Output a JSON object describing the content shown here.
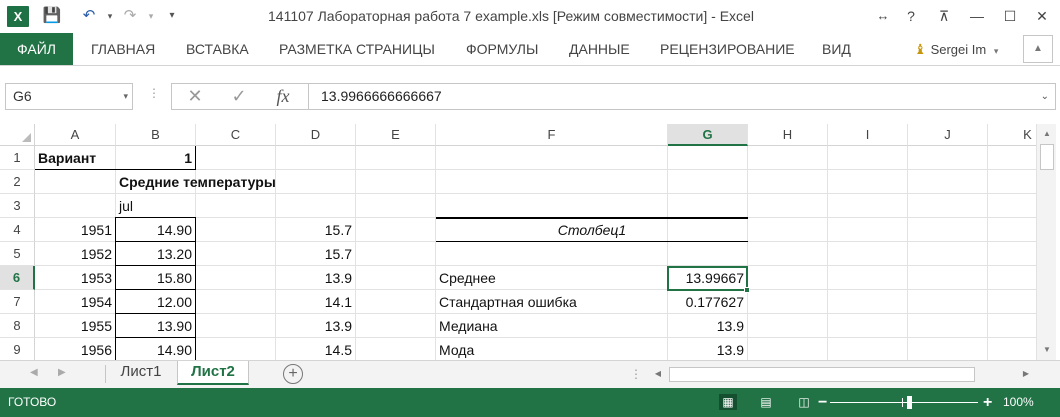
{
  "app": {
    "title": "141107 Лабораторная работа 7 example.xls  [Режим совместимости] - Excel",
    "logo": "X",
    "quick_access": [
      "save-icon",
      "undo-icon",
      "redo-icon",
      "customize-icon"
    ]
  },
  "window_controls": {
    "help": "?",
    "restore_ribbon": "⊼",
    "minimize": "—",
    "maximize": "☐",
    "close": "✕"
  },
  "ribbon": {
    "file_tab": "ФАЙЛ",
    "tabs": [
      "ГЛАВНАЯ",
      "ВСТАВКА",
      "РАЗМЕТКА СТРАНИЦЫ",
      "ФОРМУЛЫ",
      "ДАННЫЕ",
      "РЕЦЕНЗИРОВАНИЕ",
      "ВИД"
    ],
    "user": "Sergei Im"
  },
  "formula_bar": {
    "name_box": "G6",
    "cancel": "✕",
    "enter": "✓",
    "fx": "fx",
    "value": "13.9966666666667"
  },
  "grid": {
    "columns": [
      "A",
      "B",
      "C",
      "D",
      "E",
      "F",
      "G",
      "H",
      "I",
      "J",
      "K"
    ],
    "selected_column": "G",
    "rows": [
      "1",
      "2",
      "3",
      "4",
      "5",
      "6",
      "7",
      "8",
      "9"
    ],
    "selected_row": "6",
    "cells": {
      "A1": "Вариант",
      "B1": "1",
      "B2": "Средние температуры",
      "B3": "jul",
      "A4": "1951",
      "B4": "14.90",
      "D4": "15.7",
      "F4": "Столбец1",
      "A5": "1952",
      "B5": "13.20",
      "D5": "15.7",
      "A6": "1953",
      "B6": "15.80",
      "D6": "13.9",
      "F6": "Среднее",
      "G6": "13.99667",
      "A7": "1954",
      "B7": "12.00",
      "D7": "14.1",
      "F7": "Стандартная ошибка",
      "G7": "0.177627",
      "A8": "1955",
      "B8": "13.90",
      "D8": "13.9",
      "F8": "Медиана",
      "G8": "13.9",
      "A9": "1956",
      "B9": "14.90",
      "D9": "14.5",
      "F9": "Мода",
      "G9": "13.9"
    }
  },
  "sheets": {
    "tabs": [
      "Лист1",
      "Лист2"
    ],
    "active": "Лист2",
    "add": "+"
  },
  "status": {
    "text": "ГОТОВО",
    "zoom": "100%",
    "zoom_minus": "−",
    "zoom_plus": "+"
  },
  "colors": {
    "accent": "#217346",
    "selection": "#217346"
  }
}
